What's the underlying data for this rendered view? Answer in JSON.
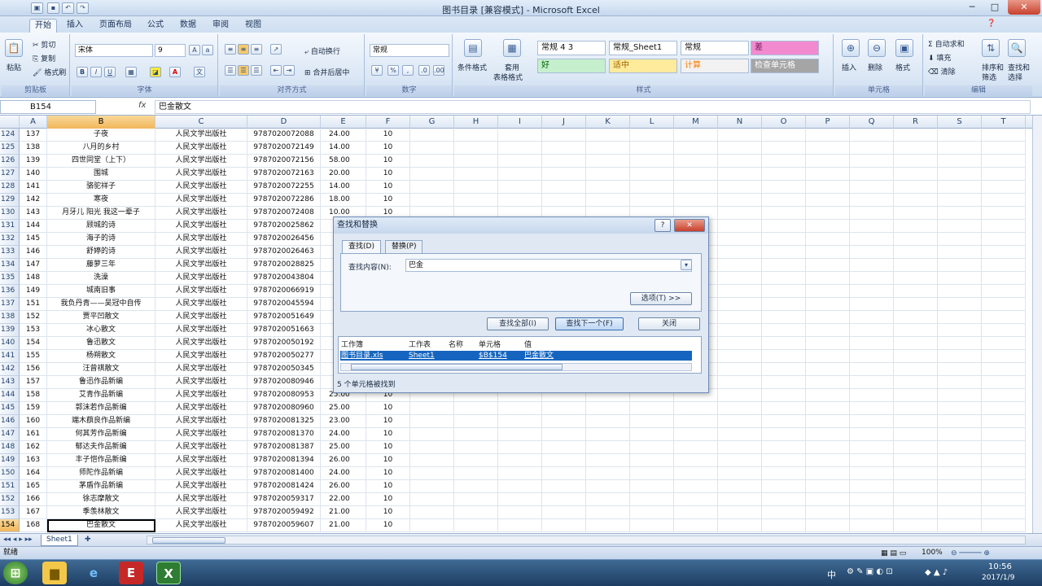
{
  "window": {
    "title": "图书目录 [兼容模式] - Microsoft Excel",
    "min": "─",
    "max": "□",
    "close": "✕"
  },
  "tabs": [
    "开始",
    "插入",
    "页面布局",
    "公式",
    "数据",
    "审阅",
    "视图"
  ],
  "ribbon": {
    "clipboard": {
      "paste": "粘贴",
      "cut": "剪切",
      "copy": "复制",
      "format_painter": "格式刷",
      "label": "剪贴板"
    },
    "font": {
      "name": "宋体",
      "size": "9",
      "label": "字体",
      "bold": "B",
      "italic": "I",
      "underline": "U"
    },
    "alignment": {
      "wrap": "自动换行",
      "merge": "合并后居中",
      "label": "对齐方式"
    },
    "number": {
      "format": "常规",
      "percent": "%",
      "label": "数字"
    },
    "styles": {
      "conditional": "条件格式",
      "table": "套用",
      "table2": "表格格式",
      "label": "样式",
      "items": [
        {
          "text": "常规 4 3",
          "bg": "#ffffff",
          "fg": "#111111"
        },
        {
          "text": "常规_Sheet1",
          "bg": "#ffffff",
          "fg": "#111111"
        },
        {
          "text": "常规",
          "bg": "#ffffff",
          "fg": "#111111"
        },
        {
          "text": "差",
          "bg": "#f28ad0",
          "fg": "#7a1a5b"
        },
        {
          "text": "好",
          "bg": "#c6efce",
          "fg": "#006100"
        },
        {
          "text": "适中",
          "bg": "#ffeb9c",
          "fg": "#9c6500"
        },
        {
          "text": "计算",
          "bg": "#f2f2f2",
          "fg": "#fa7d00"
        },
        {
          "text": "检查单元格",
          "bg": "#a5a5a5",
          "fg": "#ffffff"
        }
      ]
    },
    "cells": {
      "insert": "插入",
      "delete": "删除",
      "format": "格式",
      "label": "单元格"
    },
    "editing": {
      "autosum": "自动求和",
      "fill": "填充",
      "clear": "清除",
      "sort": "排序和",
      "sort2": "筛选",
      "find": "查找和",
      "find2": "选择",
      "label": "编辑"
    }
  },
  "formula_bar": {
    "cell_ref": "B154",
    "fx": "fx",
    "content": "巴金散文"
  },
  "columns": [
    "A",
    "B",
    "C",
    "D",
    "E",
    "F",
    "G",
    "H",
    "I",
    "J",
    "K",
    "L",
    "M",
    "N",
    "O",
    "P",
    "Q",
    "R",
    "S",
    "T"
  ],
  "rows": [
    {
      "n": "124",
      "a": "137",
      "b": "子夜",
      "c": "人民文学出版社",
      "d": "9787020072088",
      "e": "24.00",
      "f": "10"
    },
    {
      "n": "125",
      "a": "138",
      "b": "八月的乡村",
      "c": "人民文学出版社",
      "d": "9787020072149",
      "e": "14.00",
      "f": "10"
    },
    {
      "n": "126",
      "a": "139",
      "b": "四世同堂（上下）",
      "c": "人民文学出版社",
      "d": "9787020072156",
      "e": "58.00",
      "f": "10"
    },
    {
      "n": "127",
      "a": "140",
      "b": "围城",
      "c": "人民文学出版社",
      "d": "9787020072163",
      "e": "20.00",
      "f": "10"
    },
    {
      "n": "128",
      "a": "141",
      "b": "骆驼祥子",
      "c": "人民文学出版社",
      "d": "9787020072255",
      "e": "14.00",
      "f": "10"
    },
    {
      "n": "129",
      "a": "142",
      "b": "寒夜",
      "c": "人民文学出版社",
      "d": "9787020072286",
      "e": "18.00",
      "f": "10"
    },
    {
      "n": "130",
      "a": "143",
      "b": "月牙儿 阳光 我这一辈子",
      "c": "人民文学出版社",
      "d": "9787020072408",
      "e": "10.00",
      "f": "10"
    },
    {
      "n": "131",
      "a": "144",
      "b": "顾城的诗",
      "c": "人民文学出版社",
      "d": "9787020025862",
      "e": "",
      "f": ""
    },
    {
      "n": "132",
      "a": "145",
      "b": "海子的诗",
      "c": "人民文学出版社",
      "d": "9787020026456",
      "e": "",
      "f": ""
    },
    {
      "n": "133",
      "a": "146",
      "b": "舒婷的诗",
      "c": "人民文学出版社",
      "d": "9787020026463",
      "e": "",
      "f": ""
    },
    {
      "n": "134",
      "a": "147",
      "b": "藤萝三年",
      "c": "人民文学出版社",
      "d": "9787020028825",
      "e": "",
      "f": ""
    },
    {
      "n": "135",
      "a": "148",
      "b": "洗澡",
      "c": "人民文学出版社",
      "d": "9787020043804",
      "e": "",
      "f": ""
    },
    {
      "n": "136",
      "a": "149",
      "b": "城南旧事",
      "c": "人民文学出版社",
      "d": "9787020066919",
      "e": "",
      "f": ""
    },
    {
      "n": "137",
      "a": "151",
      "b": "我负丹青——吴冠中自传",
      "c": "人民文学出版社",
      "d": "9787020045594",
      "e": "",
      "f": ""
    },
    {
      "n": "138",
      "a": "152",
      "b": "贾平凹散文",
      "c": "人民文学出版社",
      "d": "9787020051649",
      "e": "",
      "f": ""
    },
    {
      "n": "139",
      "a": "153",
      "b": "冰心散文",
      "c": "人民文学出版社",
      "d": "9787020051663",
      "e": "",
      "f": ""
    },
    {
      "n": "140",
      "a": "154",
      "b": "鲁迅散文",
      "c": "人民文学出版社",
      "d": "9787020050192",
      "e": "",
      "f": ""
    },
    {
      "n": "141",
      "a": "155",
      "b": "杨朔散文",
      "c": "人民文学出版社",
      "d": "9787020050277",
      "e": "",
      "f": ""
    },
    {
      "n": "142",
      "a": "156",
      "b": "汪曾祺散文",
      "c": "人民文学出版社",
      "d": "9787020050345",
      "e": "",
      "f": ""
    },
    {
      "n": "143",
      "a": "157",
      "b": "鲁迅作品新编",
      "c": "人民文学出版社",
      "d": "9787020080946",
      "e": "",
      "f": ""
    },
    {
      "n": "144",
      "a": "158",
      "b": "艾青作品新编",
      "c": "人民文学出版社",
      "d": "9787020080953",
      "e": "25.00",
      "f": "10"
    },
    {
      "n": "145",
      "a": "159",
      "b": "郭沫若作品新编",
      "c": "人民文学出版社",
      "d": "9787020080960",
      "e": "25.00",
      "f": "10"
    },
    {
      "n": "146",
      "a": "160",
      "b": "端木蕻良作品新编",
      "c": "人民文学出版社",
      "d": "9787020081325",
      "e": "23.00",
      "f": "10"
    },
    {
      "n": "147",
      "a": "161",
      "b": "何其芳作品新编",
      "c": "人民文学出版社",
      "d": "9787020081370",
      "e": "24.00",
      "f": "10"
    },
    {
      "n": "148",
      "a": "162",
      "b": "郁达夫作品新编",
      "c": "人民文学出版社",
      "d": "9787020081387",
      "e": "25.00",
      "f": "10"
    },
    {
      "n": "149",
      "a": "163",
      "b": "丰子恺作品新编",
      "c": "人民文学出版社",
      "d": "9787020081394",
      "e": "26.00",
      "f": "10"
    },
    {
      "n": "150",
      "a": "164",
      "b": "师陀作品新编",
      "c": "人民文学出版社",
      "d": "9787020081400",
      "e": "24.00",
      "f": "10"
    },
    {
      "n": "151",
      "a": "165",
      "b": "茅盾作品新编",
      "c": "人民文学出版社",
      "d": "9787020081424",
      "e": "26.00",
      "f": "10"
    },
    {
      "n": "152",
      "a": "166",
      "b": "徐志摩散文",
      "c": "人民文学出版社",
      "d": "9787020059317",
      "e": "22.00",
      "f": "10"
    },
    {
      "n": "153",
      "a": "167",
      "b": "季羡林散文",
      "c": "人民文学出版社",
      "d": "9787020059492",
      "e": "21.00",
      "f": "10"
    },
    {
      "n": "154",
      "a": "168",
      "b": "巴金散文",
      "c": "人民文学出版社",
      "d": "9787020059607",
      "e": "21.00",
      "f": "10"
    }
  ],
  "sheet_tab": "Sheet1",
  "status": {
    "ready": "就绪",
    "zoom": "100%"
  },
  "dialog": {
    "title": "查找和替换",
    "help": "?",
    "close": "✕",
    "tab_find": "查找(D)",
    "tab_replace": "替换(P)",
    "find_label": "查找内容(N):",
    "find_value": "巴金",
    "options": "选项(T) >>",
    "find_all": "查找全部(I)",
    "find_next": "查找下一个(F)",
    "close_btn": "关闭",
    "headers": {
      "workbook": "工作簿",
      "sheet": "工作表",
      "name": "名称",
      "cell": "单元格",
      "value": "值"
    },
    "result": {
      "workbook": "图书目录.xls",
      "sheet": "Sheet1",
      "cell": "$B$154",
      "value": "巴金散文"
    },
    "found": "5 个单元格被找到"
  },
  "taskbar": {
    "ime": "中",
    "time": "10:56",
    "date": "2017/1/9"
  }
}
